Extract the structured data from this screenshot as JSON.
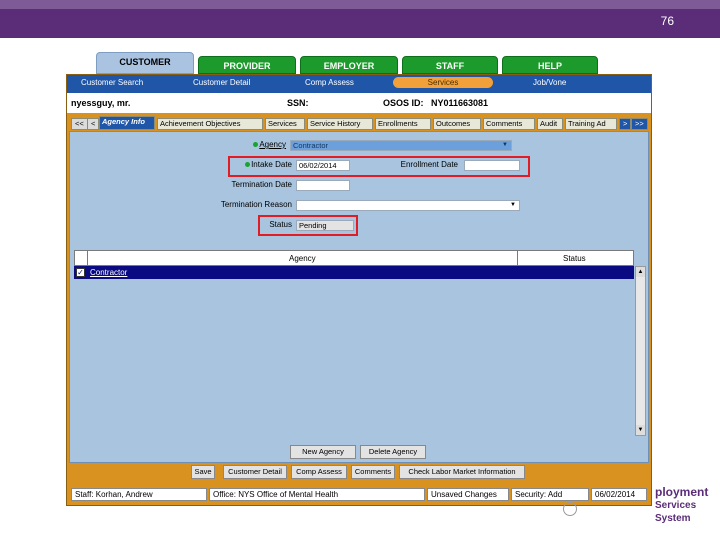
{
  "slide": {
    "page_number": "76",
    "logo_line1": "ployment",
    "logo_line2": "Services System"
  },
  "modules": [
    {
      "label": "CUSTOMER",
      "active": true
    },
    {
      "label": "PROVIDER"
    },
    {
      "label": "EMPLOYER"
    },
    {
      "label": "STAFF"
    },
    {
      "label": "HELP"
    }
  ],
  "subnav": [
    "Customer Search",
    "Customer Detail",
    "Comp Assess",
    "Services",
    "Job/Vone"
  ],
  "customer": {
    "name": "nyessguy, mr.",
    "ssn_label": "SSN:",
    "osos_label": "OSOS ID:",
    "osos_id": "NY011663081"
  },
  "tabs": {
    "left_nav": [
      "<<",
      "<"
    ],
    "items": [
      "Agency Info",
      "Achievement Objectives",
      "Services",
      "Service History",
      "Enrollments",
      "Outcomes",
      "Comments",
      "Audit",
      "Training Ad"
    ],
    "right_nav": [
      ">",
      ">>"
    ]
  },
  "form": {
    "agency_label": "Agency",
    "agency_value": "Contractor",
    "intake_label": "Intake Date",
    "intake_value": "06/02/2014",
    "enrollment_label": "Enrollment Date",
    "enrollment_value": "",
    "termination_date_label": "Termination Date",
    "termination_date_value": "",
    "termination_reason_label": "Termination Reason",
    "termination_reason_value": "",
    "status_label": "Status",
    "status_value": "Pending"
  },
  "grid": {
    "columns": [
      "Agency",
      "Status"
    ],
    "rows": [
      {
        "checked": true,
        "agency": "Contractor",
        "status": ""
      }
    ]
  },
  "grid_buttons": {
    "new": "New Agency",
    "delete": "Delete Agency"
  },
  "bottom_buttons": [
    "Save",
    "Customer Detail",
    "Comp Assess",
    "Comments",
    "Check Labor Market Information"
  ],
  "status_bar": {
    "staff": "Staff: Korhan, Andrew",
    "office": "Office: NYS Office of Mental Health",
    "changes": "Unsaved Changes",
    "security": "Security: Add",
    "date": "06/02/2014"
  },
  "colors": {
    "header": "#5b2d78",
    "tab_green": "#1d9a2c",
    "app_orange": "#d99220",
    "nav_blue": "#1f56a8",
    "highlight_red": "#e11c24"
  }
}
